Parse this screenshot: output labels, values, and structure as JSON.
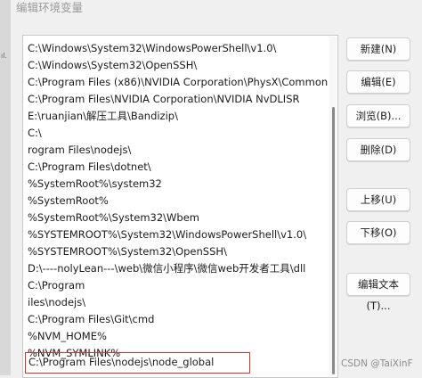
{
  "window": {
    "title": "编辑环境变量"
  },
  "left_strip": {
    "mark": "ıl."
  },
  "path_entries": [
    "C:\\Windows\\System32\\WindowsPowerShell\\v1.0\\",
    "C:\\Windows\\System32\\OpenSSH\\",
    "C:\\Program Files (x86)\\NVIDIA Corporation\\PhysX\\Common",
    "C:\\Program Files\\NVIDIA Corporation\\NVIDIA NvDLISR",
    "E:\\ruanjian\\解压工具\\Bandizip\\",
    "C:\\",
    "rogram Files\\nodejs\\",
    "C:\\Program Files\\dotnet\\",
    "%SystemRoot%\\system32",
    "%SystemRoot%",
    "%SystemRoot%\\System32\\Wbem",
    "%SYSTEMROOT%\\System32\\WindowsPowerShell\\v1.0\\",
    "%SYSTEMROOT%\\System32\\OpenSSH\\",
    "D:\\----nolyLean---\\web\\微信小程序\\微信web开发者工具\\dll",
    "C:\\Program",
    "iles\\nodejs\\",
    "C:\\Program Files\\Git\\cmd",
    "%NVM_HOME%",
    "%NVM_SYMLINK%",
    "C:\\Program Files\\nodejs\\node_global"
  ],
  "highlighted_index": 19,
  "buttons": {
    "new": "新建(N)",
    "edit": "编辑(E)",
    "browse": "浏览(B)...",
    "delete": "删除(D)",
    "move_up": "上移(U)",
    "move_down": "下移(O)",
    "edit_text": "编辑文本(T)..."
  },
  "watermark": "CSDN @TaiXinF"
}
